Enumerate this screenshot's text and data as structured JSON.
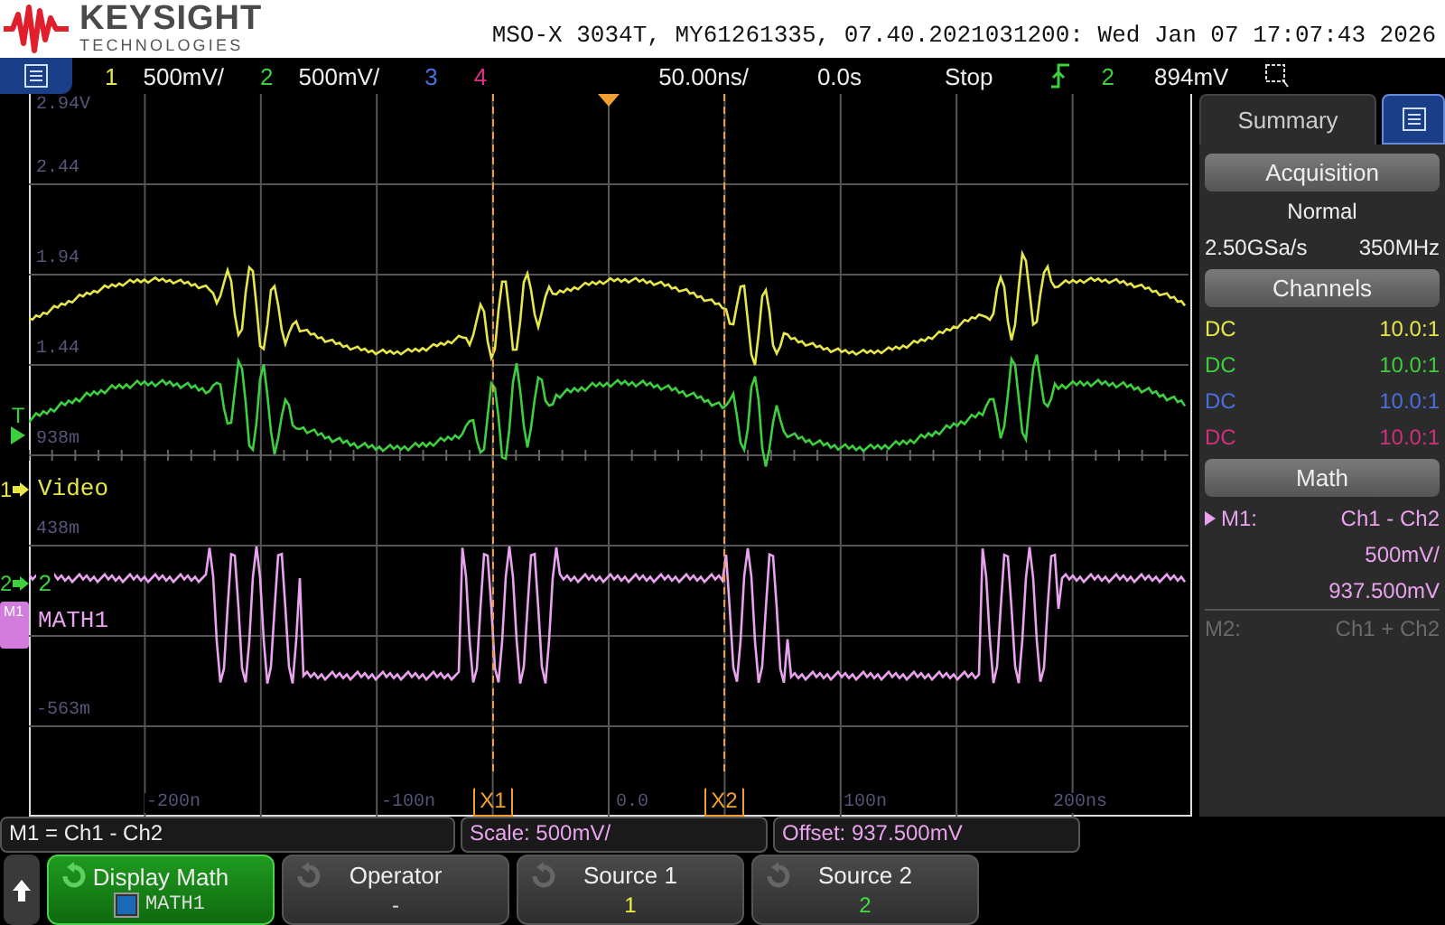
{
  "header": {
    "brand": "KEYSIGHT",
    "subbrand": "TECHNOLOGIES",
    "title": "MSO-X 3034T, MY61261335, 07.40.2021031200: Wed Jan 07 17:07:43 2026"
  },
  "status_bar": {
    "channels": [
      {
        "number": "1",
        "scale": "500mV/",
        "color": "#e6e64a"
      },
      {
        "number": "2",
        "scale": "500mV/",
        "color": "#3ecf3e"
      },
      {
        "number": "3",
        "color": "#4a6ee0"
      },
      {
        "number": "4",
        "color": "#e0308a"
      }
    ],
    "timebase": "50.00ns/",
    "delay": "0.0s",
    "run_state": "Stop",
    "trigger_source": "2",
    "trigger_level": "894mV"
  },
  "graticule": {
    "y_labels": [
      "2.94V",
      "2.44",
      "1.94",
      "1.44",
      "938m",
      "438m",
      "-563m"
    ],
    "x_labels": [
      "-200n",
      "-100n",
      "0.0",
      "100n",
      "200ns"
    ],
    "cursors": [
      "X1",
      "X2"
    ],
    "markers": [
      {
        "kind": "trigger",
        "label": "T",
        "color": "#3ecf3e"
      },
      {
        "kind": "channel",
        "label": "1",
        "color": "#e6e64a"
      },
      {
        "kind": "channel",
        "label": "2",
        "color": "#3ecf3e"
      },
      {
        "kind": "math",
        "label": "M1",
        "color": "#d27ddc"
      }
    ],
    "trace_labels": [
      {
        "text": "Video",
        "color": "#e6e64a"
      },
      {
        "text": "2",
        "color": "#3ecf3e"
      },
      {
        "text": "MATH1",
        "color": "#e9a3ee"
      }
    ]
  },
  "side_panel": {
    "tabs": [
      {
        "label": "Summary",
        "selected": true
      }
    ],
    "acquisition": {
      "title": "Acquisition",
      "mode": "Normal",
      "sample_rate": "2.50GSa/s",
      "bandwidth": "350MHz"
    },
    "channels_title": "Channels",
    "channels": [
      {
        "coupling": "DC",
        "probe": "10.0:1",
        "color": "#e6e64a"
      },
      {
        "coupling": "DC",
        "probe": "10.0:1",
        "color": "#3ecf3e"
      },
      {
        "coupling": "DC",
        "probe": "10.0:1",
        "color": "#4a6ee0"
      },
      {
        "coupling": "DC",
        "probe": "10.0:1",
        "color": "#d0307a"
      }
    ],
    "math_title": "Math",
    "math": [
      {
        "name": "M1:",
        "expression": "Ch1 - Ch2",
        "scale": "500mV/",
        "offset": "937.500mV",
        "selected": true
      },
      {
        "name": "M2:",
        "expression": "Ch1 + Ch2",
        "selected": false
      }
    ]
  },
  "info_bar": [
    {
      "text": "M1 = Ch1 - Ch2",
      "kind": "plain"
    },
    {
      "text": "Scale: 500mV/",
      "kind": "math"
    },
    {
      "text": "Offset: 937.500mV",
      "kind": "math"
    }
  ],
  "softkeys": [
    {
      "label": "Display Math",
      "kind": "toggle",
      "active": true,
      "checked": true,
      "value": "MATH1"
    },
    {
      "label": "Operator",
      "kind": "knob",
      "active": false,
      "value": "-",
      "color": "#dddddd"
    },
    {
      "label": "Source 1",
      "kind": "knob",
      "active": false,
      "value": "1",
      "color": "#f0f040"
    },
    {
      "label": "Source 2",
      "kind": "knob",
      "active": false,
      "value": "2",
      "color": "#40e040"
    }
  ]
}
